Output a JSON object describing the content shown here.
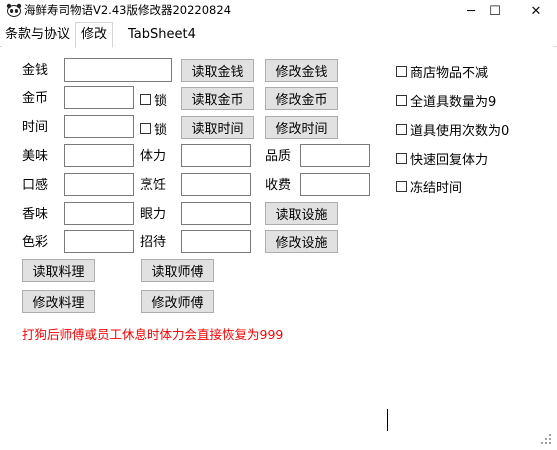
{
  "window": {
    "title": "海鲜寿司物语V2.43版修改器20220824",
    "minimize_glyph": "─",
    "maximize_glyph": "☐",
    "close_glyph": "✕",
    "icon": "panda-app-icon"
  },
  "tabs": [
    {
      "label": "条款与协议"
    },
    {
      "label": "修改",
      "active": true
    },
    {
      "label": "TabSheet4"
    }
  ],
  "form": {
    "money_label": "金钱",
    "gold_label": "金币",
    "time_label": "时间",
    "lock_label": "锁",
    "taste_label": "美味",
    "mouthfeel_label": "口感",
    "aroma_label": "香味",
    "color_label": "色彩",
    "stamina_label": "体力",
    "cooking_label": "烹饪",
    "eyesight_label": "眼力",
    "hospitality_label": "招待",
    "quality_label": "品质",
    "fee_label": "收费"
  },
  "buttons": {
    "read_money": "读取金钱",
    "modify_money": "修改金钱",
    "read_gold": "读取金币",
    "modify_gold": "修改金币",
    "read_time": "读取时间",
    "modify_time": "修改时间",
    "read_facility": "读取设施",
    "modify_facility": "修改设施",
    "read_dish": "读取料理",
    "modify_dish": "修改料理",
    "read_chef": "读取师傅",
    "modify_chef": "修改师傅"
  },
  "options": [
    {
      "label": "商店物品不减",
      "checked": false
    },
    {
      "label": "全道具数量为9",
      "checked": false
    },
    {
      "label": "道具使用次数为0",
      "checked": false
    },
    {
      "label": "快速回复体力",
      "checked": false
    },
    {
      "label": "冻结时间",
      "checked": false
    }
  ],
  "note": "打狗后师傅或员工休息时体力会直接恢复为999",
  "colors": {
    "note": "#ff0000",
    "button_face": "#e1e1e1",
    "button_border": "#adadad"
  }
}
